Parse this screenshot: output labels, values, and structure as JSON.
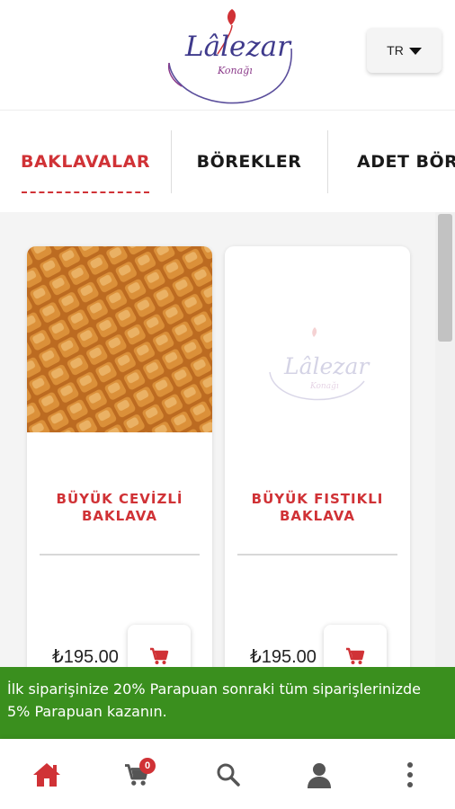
{
  "header": {
    "logo_text": "Lâlezar",
    "logo_subtext": "Konağı",
    "language": "TR"
  },
  "tabs": [
    {
      "label": "BAKLAVALAR",
      "active": true
    },
    {
      "label": "BÖREKLER",
      "active": false
    },
    {
      "label": "ADET BÖR",
      "active": false
    }
  ],
  "products": [
    {
      "name": "BÜYÜK CEVİZLİ BAKLAVA",
      "price": "₺195.00",
      "image": "baklava-photo"
    },
    {
      "name": "BÜYÜK FISTIKLI BAKLAVA",
      "price": "₺195.00",
      "image": "logo-placeholder"
    }
  ],
  "promo": {
    "text": "İlk siparişinize 20% Parapuan sonraki tüm siparişlerinizde 5% Parapuan kazanın."
  },
  "bottom_nav": {
    "cart_count": "0",
    "items": [
      "home-icon",
      "cart-icon",
      "search-icon",
      "user-icon",
      "more-icon"
    ]
  },
  "colors": {
    "accent": "#d03236",
    "promo_bg": "#3a8f1e",
    "content_bg": "#f4f4f4"
  }
}
